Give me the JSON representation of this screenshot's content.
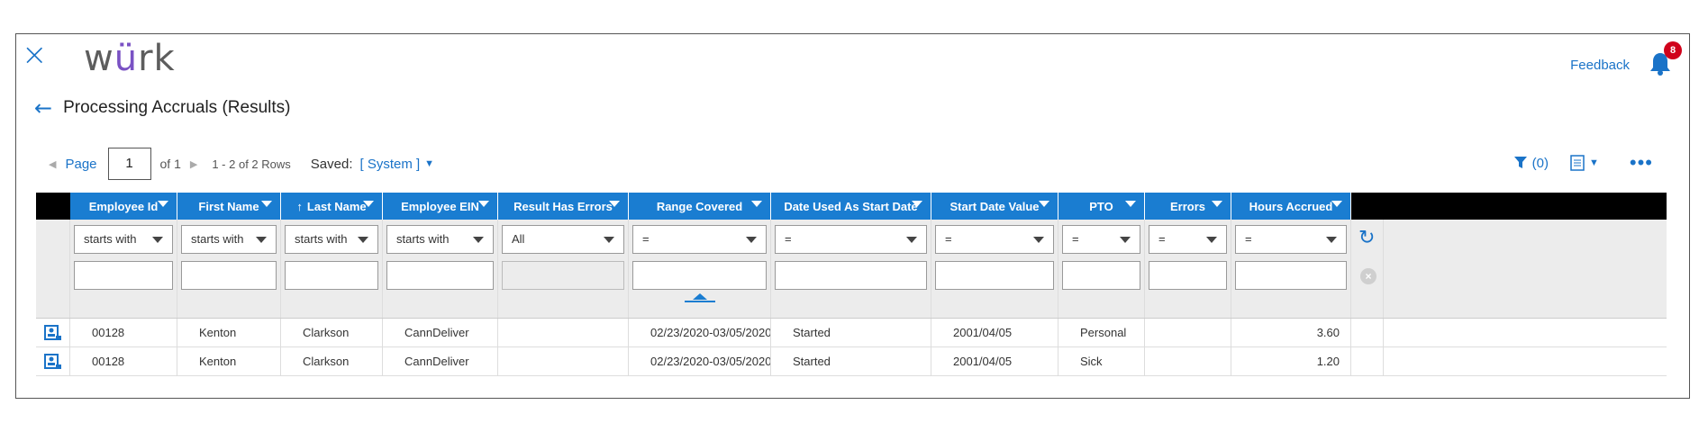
{
  "app": {
    "close_icon": "close-icon",
    "logo_prefix": "w",
    "logo_u": "ü",
    "logo_suffix": "rk",
    "feedback": "Feedback",
    "notifications_count": "8"
  },
  "page": {
    "title": "Processing Accruals (Results)"
  },
  "pagination": {
    "page_label": "Page",
    "page_value": "1",
    "of_text": "of 1",
    "rows_text": "1 - 2 of 2 Rows",
    "saved_label": "Saved:",
    "saved_value": "[ System ]"
  },
  "tools": {
    "filter_count": "(0)"
  },
  "columns": [
    {
      "label": "Employee Id",
      "filter_op": "starts with"
    },
    {
      "label": "First Name",
      "filter_op": "starts with"
    },
    {
      "label": "Last Name",
      "filter_op": "starts with",
      "sorted": "asc"
    },
    {
      "label": "Employee EIN",
      "filter_op": "starts with"
    },
    {
      "label": "Result Has Errors",
      "filter_op": "All"
    },
    {
      "label": "Range Covered",
      "filter_op": "="
    },
    {
      "label": "Date Used As Start Date",
      "filter_op": "="
    },
    {
      "label": "Start Date Value",
      "filter_op": "="
    },
    {
      "label": "PTO",
      "filter_op": "="
    },
    {
      "label": "Errors",
      "filter_op": "="
    },
    {
      "label": "Hours Accrued",
      "filter_op": "="
    }
  ],
  "sort_arrow": "↑",
  "rows": [
    {
      "employee_id": "00128",
      "first_name": "Kenton",
      "last_name": "Clarkson",
      "employee_ein": "CannDeliver",
      "result_has_errors": "",
      "range_covered": "02/23/2020-03/05/2020",
      "date_used": "Started",
      "start_date_value": "2001/04/05",
      "pto": "Personal",
      "errors": "",
      "hours_accrued": "3.60"
    },
    {
      "employee_id": "00128",
      "first_name": "Kenton",
      "last_name": "Clarkson",
      "employee_ein": "CannDeliver",
      "result_has_errors": "",
      "range_covered": "02/23/2020-03/05/2020",
      "date_used": "Started",
      "start_date_value": "2001/04/05",
      "pto": "Sick",
      "errors": "",
      "hours_accrued": "1.20"
    }
  ],
  "colors": {
    "accent": "#1a73c8",
    "header_bg": "#1a7dd1",
    "badge": "#d0021b"
  }
}
